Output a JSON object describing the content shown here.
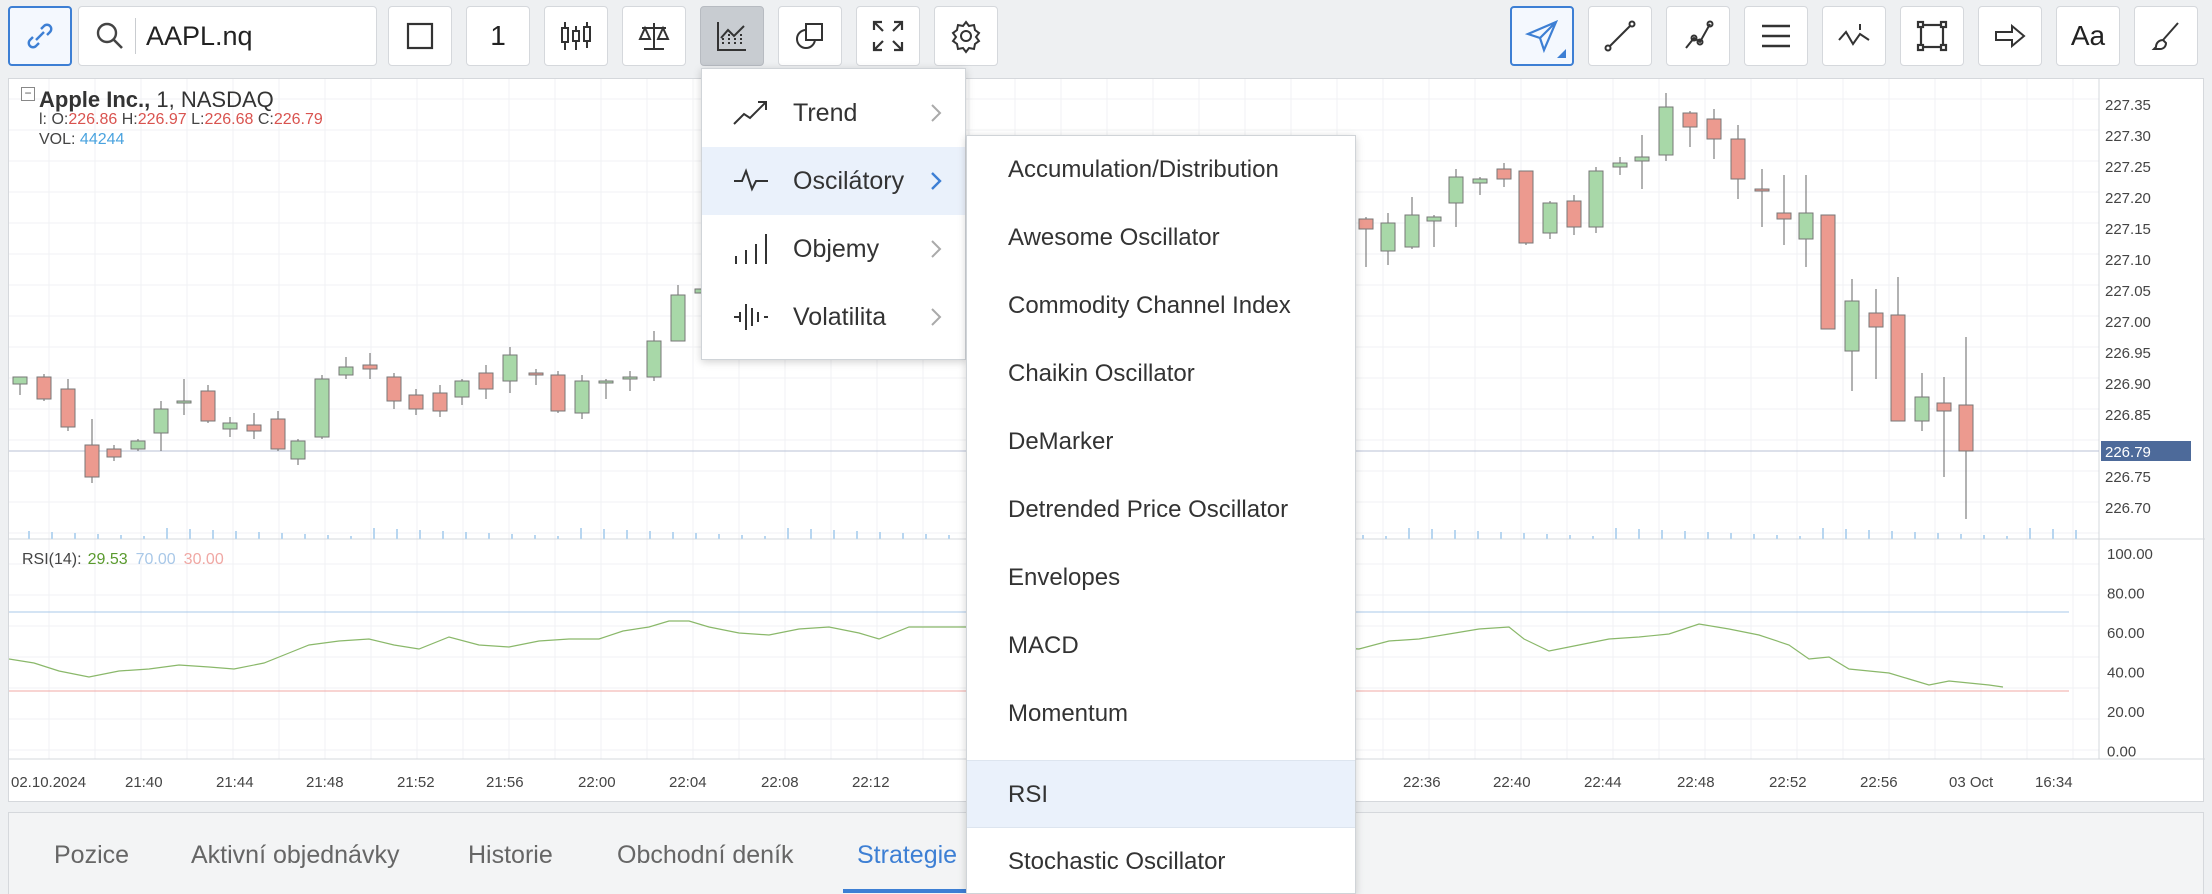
{
  "toolbar": {
    "symbol": "AAPL.nq",
    "interval": "1",
    "font_button_label": "Aa"
  },
  "chart": {
    "name": "Apple Inc.,",
    "interval": "1,",
    "exchange": "NASDAQ",
    "ohlc": {
      "o_label": "l: O:",
      "o": "226.86",
      "h_label": "H:",
      "h": "226.97",
      "l_label": "L:",
      "l": "226.68",
      "c_label": "C:",
      "c": "226.79"
    },
    "vol_label": "VOL:",
    "vol": "44244",
    "current_price": "226.79",
    "price_axis": [
      "227.35",
      "227.30",
      "227.25",
      "227.20",
      "227.15",
      "227.10",
      "227.05",
      "227.00",
      "226.95",
      "226.90",
      "226.85",
      "226.75",
      "226.70"
    ],
    "rsi": {
      "label": "RSI(14):",
      "value": "29.53",
      "upper": "70.00",
      "lower": "30.00"
    },
    "rsi_axis": [
      "100.00",
      "80.00",
      "60.00",
      "40.00",
      "20.00",
      "0.00"
    ],
    "time_axis": [
      "02.10.2024",
      "21:40",
      "21:44",
      "21:48",
      "21:52",
      "21:56",
      "22:00",
      "22:04",
      "22:08",
      "22:12",
      "22:36",
      "22:40",
      "22:44",
      "22:48",
      "22:52",
      "22:56",
      "03 Oct",
      "16:34"
    ]
  },
  "indicator_menu": {
    "items": [
      {
        "label": "Trend",
        "icon": "trend-icon"
      },
      {
        "label": "Oscilátory",
        "icon": "oscillator-icon"
      },
      {
        "label": "Objemy",
        "icon": "volume-icon"
      },
      {
        "label": "Volatilita",
        "icon": "volatility-icon"
      }
    ],
    "highlighted": "Oscilátory"
  },
  "oscillators_menu": {
    "items": [
      "Accumulation/Distribution",
      "Awesome Oscillator",
      "Commodity Channel Index",
      "Chaikin Oscillator",
      "DeMarker",
      "Detrended Price Oscillator",
      "Envelopes",
      "MACD",
      "Momentum",
      "RSI",
      "Stochastic Oscillator"
    ],
    "highlighted": "RSI"
  },
  "bottom_tabs": {
    "items": [
      "Pozice",
      "Aktivní objednávky",
      "Historie",
      "Obchodní deník",
      "Strategie"
    ],
    "active": "Strategie"
  },
  "colors": {
    "accent": "#3d7fd4",
    "bull": "#a8d8a8",
    "bear": "#ec9a8f",
    "rsi_line": "#8ab86a"
  }
}
